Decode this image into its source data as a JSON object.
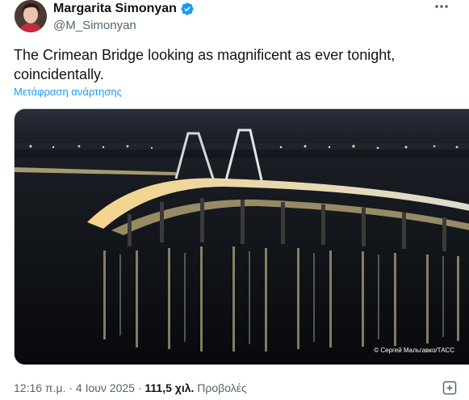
{
  "author": {
    "display_name": "Margarita Simonyan",
    "handle": "@M_Simonyan"
  },
  "tweet": {
    "text": "The Crimean Bridge looking as magnificent as ever tonight, coincidentally.",
    "translate_link": "Μετάφραση ανάρτησης"
  },
  "media": {
    "photo_credit": "© Сергей Мальгавко/ТАСС"
  },
  "meta": {
    "time": "12:16 π.μ.",
    "separator": "·",
    "date": "4 Ιουν 2025",
    "views_count": "111,5 χιλ.",
    "views_label": "Προβολές"
  },
  "icons": {
    "verified": "verified-badge-icon",
    "more": "more-options-icon",
    "bookmark": "bookmark-icon"
  },
  "colors": {
    "accent": "#1d9bf0",
    "secondary_text": "#536471"
  }
}
